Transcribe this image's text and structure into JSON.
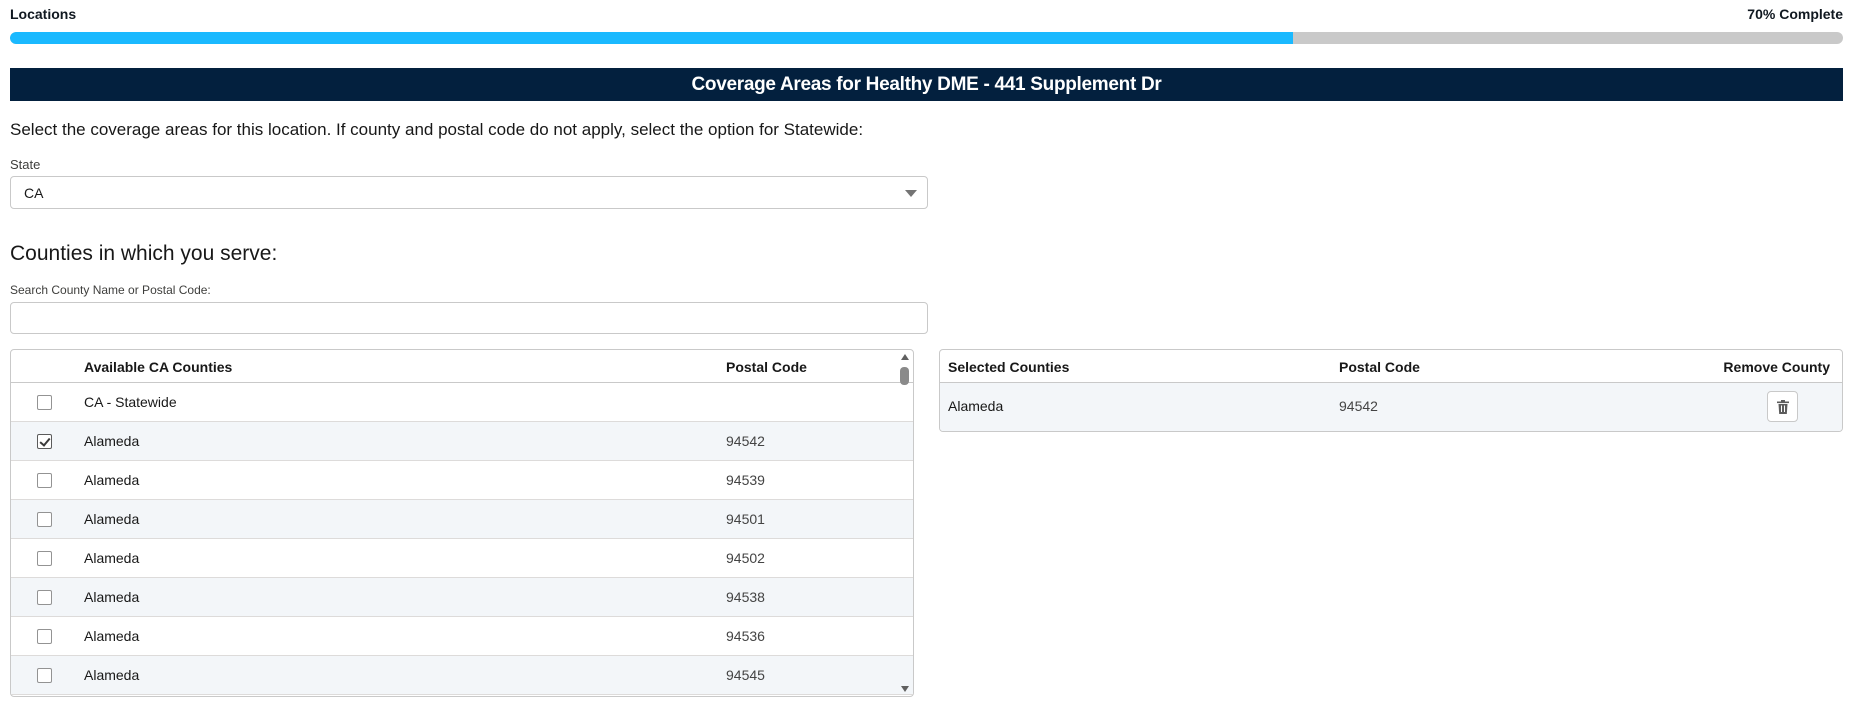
{
  "header": {
    "title": "Locations",
    "progress_text": "70% Complete",
    "progress_fraction": 0.7
  },
  "banner": {
    "title": "Coverage Areas for Healthy DME - 441 Supplement Dr"
  },
  "instruction": "Select the coverage areas for this location. If county and postal code do not apply, select the option for Statewide:",
  "state": {
    "label": "State",
    "value": "CA"
  },
  "counties": {
    "heading": "Counties in which you serve:",
    "search_label": "Search County Name or Postal Code:",
    "search_value": "",
    "search_placeholder": ""
  },
  "available_table": {
    "columns": [
      "Available CA Counties",
      "Postal Code"
    ],
    "rows": [
      {
        "county": "CA - Statewide",
        "postal_code": "",
        "checked": false
      },
      {
        "county": "Alameda",
        "postal_code": "94542",
        "checked": true
      },
      {
        "county": "Alameda",
        "postal_code": "94539",
        "checked": false
      },
      {
        "county": "Alameda",
        "postal_code": "94501",
        "checked": false
      },
      {
        "county": "Alameda",
        "postal_code": "94502",
        "checked": false
      },
      {
        "county": "Alameda",
        "postal_code": "94538",
        "checked": false
      },
      {
        "county": "Alameda",
        "postal_code": "94536",
        "checked": false
      },
      {
        "county": "Alameda",
        "postal_code": "94545",
        "checked": false
      }
    ]
  },
  "selected_table": {
    "columns": [
      "Selected Counties",
      "Postal Code",
      "Remove County"
    ],
    "rows": [
      {
        "county": "Alameda",
        "postal_code": "94542",
        "remove_icon": "trash-icon"
      }
    ]
  },
  "colors": {
    "progress_fill": "#1ab9ff",
    "progress_track": "#c9c9c9",
    "banner_bg": "#03203e"
  }
}
